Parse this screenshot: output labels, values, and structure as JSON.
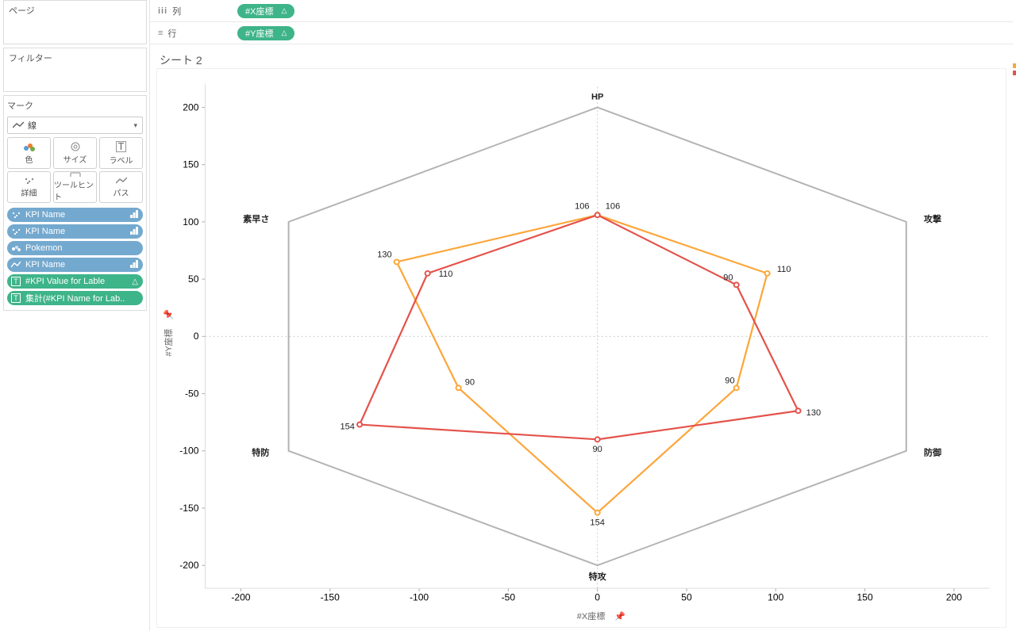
{
  "panels": {
    "pages": "ページ",
    "filters": "フィルター",
    "marks": "マーク"
  },
  "mark_type": "線",
  "mark_buttons": {
    "color": "色",
    "size": "サイズ",
    "label": "ラベル",
    "detail": "詳細",
    "tooltip": "ツールヒント",
    "path": "パス"
  },
  "mark_pills": [
    {
      "icon": "detail",
      "label": "KPI Name",
      "color": "blue",
      "right": "sort"
    },
    {
      "icon": "detail",
      "label": "KPI Name",
      "color": "blue",
      "right": "sort"
    },
    {
      "icon": "color",
      "label": "Pokemon",
      "color": "blue",
      "right": ""
    },
    {
      "icon": "path",
      "label": "KPI Name",
      "color": "blue",
      "right": "sort"
    },
    {
      "icon": "text",
      "label": "#KPI Value for Lable",
      "color": "green",
      "right": "delta"
    },
    {
      "icon": "text",
      "label": "集計(#KPI Name for Lab..",
      "color": "green",
      "right": ""
    }
  ],
  "shelves": {
    "cols_label": "列",
    "rows_label": "行",
    "cols_pill": "#X座標",
    "rows_pill": "#Y座標"
  },
  "sheet_title": "シート 2",
  "axes": {
    "x_title": "#X座標",
    "y_title": "#Y座標",
    "x_ticks": [
      -200,
      -150,
      -100,
      -50,
      0,
      50,
      100,
      150,
      200
    ],
    "y_ticks": [
      -200,
      -150,
      -100,
      -50,
      0,
      50,
      100,
      150,
      200
    ]
  },
  "chart_data": {
    "type": "line",
    "max_radius_value": 200,
    "categories": [
      "HP",
      "攻撃",
      "防御",
      "特攻",
      "特防",
      "素早さ"
    ],
    "series": [
      {
        "name": "orange",
        "color": "#fca63a",
        "values": [
          106,
          110,
          90,
          154,
          90,
          130
        ]
      },
      {
        "name": "red",
        "color": "#e4524b",
        "values": [
          106,
          90,
          130,
          90,
          154,
          110
        ]
      }
    ],
    "labels_visible": {
      "orange": {
        "HP": "106",
        "攻撃": "110",
        "防御": "90",
        "特攻": "154",
        "特防": "90",
        "素早さ": "130"
      },
      "red": {
        "HP": "106",
        "攻撃": "90",
        "防御": "130",
        "特攻": "90",
        "特防": "154",
        "素早さ": "110"
      }
    },
    "axis_origin_note": "HPが上方向、時計回りに6軸"
  }
}
